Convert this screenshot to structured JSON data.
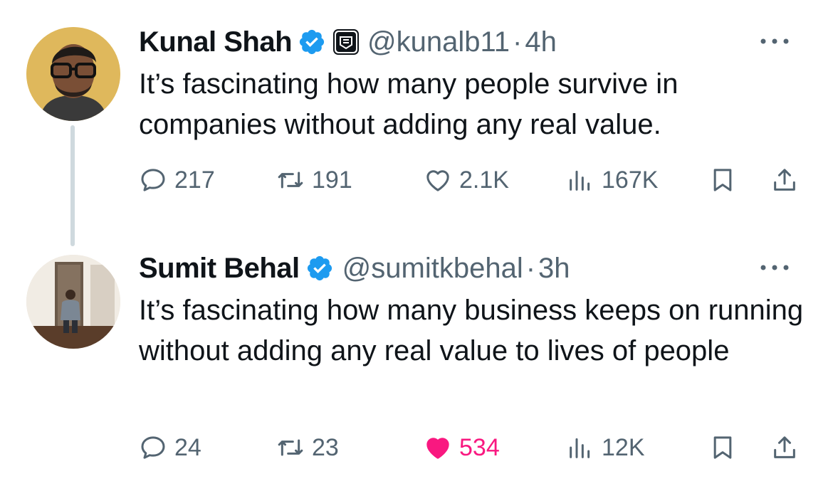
{
  "tweets": [
    {
      "author": {
        "name": "Kunal Shah",
        "handle": "@kunalb11",
        "verified": true,
        "org_badge": true
      },
      "separator": "·",
      "time": "4h",
      "text": "It’s fascinating how many people survive in companies without adding any real value.",
      "metrics": {
        "replies": "217",
        "reposts": "191",
        "likes": "2.1K",
        "views": "167K"
      },
      "liked": false
    },
    {
      "author": {
        "name": "Sumit Behal",
        "handle": "@sumitkbehal",
        "verified": true,
        "org_badge": false
      },
      "separator": "·",
      "time": "3h",
      "text": "It’s fascinating how many business keeps on running without adding any real value to lives of people",
      "metrics": {
        "replies": "24",
        "reposts": "23",
        "likes": "534",
        "views": "12K"
      },
      "liked": true
    }
  ],
  "colors": {
    "verified_blue": "#1d9bf0",
    "like_pink": "#f91880",
    "secondary_text": "#536471",
    "thread_line": "#cfd9de"
  },
  "icons": {
    "reply": "reply-icon",
    "repost": "repost-icon",
    "like": "heart-icon",
    "views": "views-icon",
    "bookmark": "bookmark-icon",
    "share": "share-icon",
    "more": "more-icon"
  }
}
